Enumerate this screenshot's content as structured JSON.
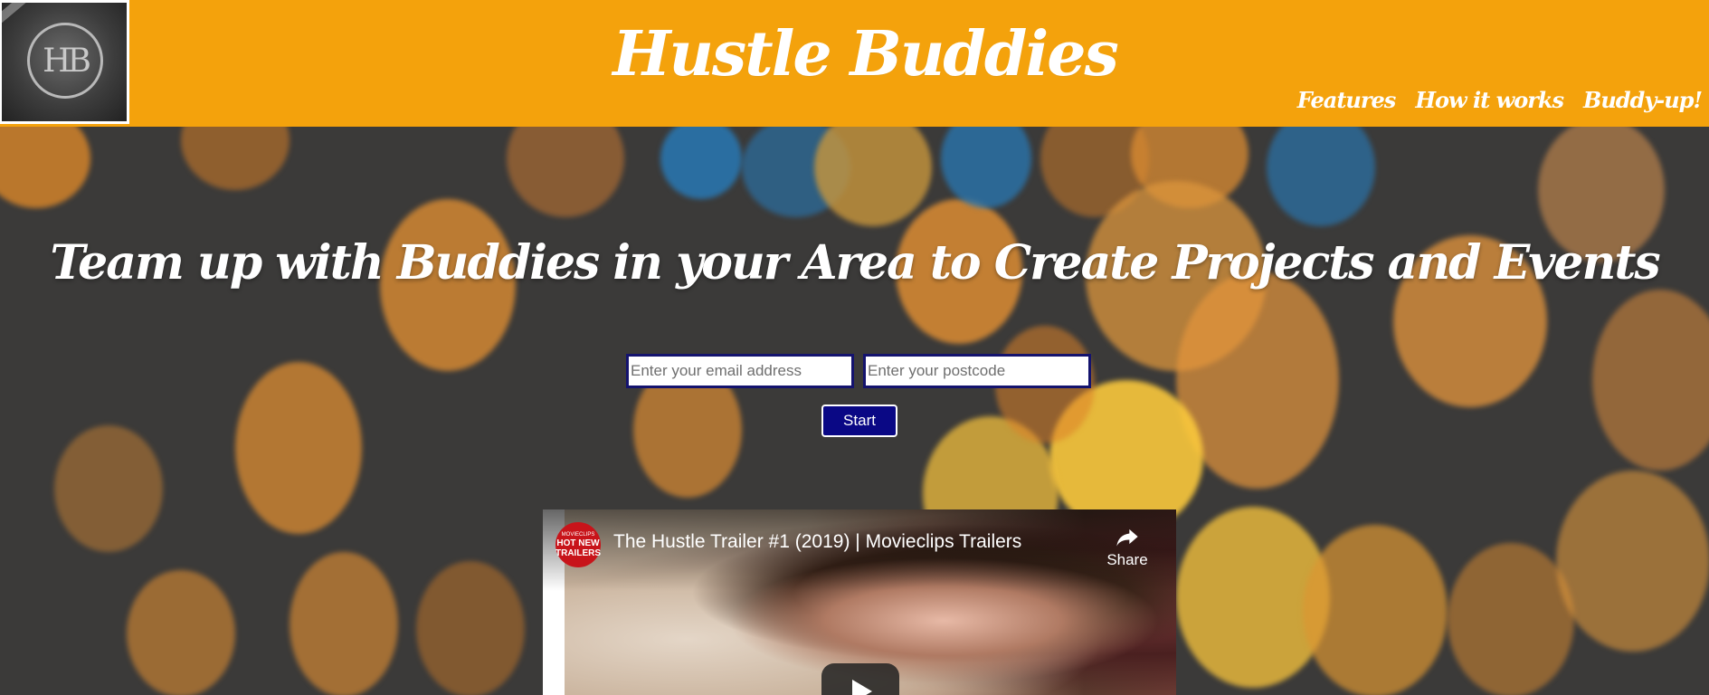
{
  "header": {
    "logo_text": "HB",
    "title": "Hustle Buddies",
    "nav": [
      {
        "label": "Features"
      },
      {
        "label": "How it works"
      },
      {
        "label": "Buddy-up!"
      }
    ],
    "background_color": "#f4a20c"
  },
  "hero": {
    "heading": "Team up with Buddies in your Area to Create Projects and Events",
    "email_placeholder": "Enter your email address",
    "postcode_placeholder": "Enter your postcode",
    "start_label": "Start",
    "button_color": "#0a0885"
  },
  "video": {
    "channel_badge_top": "MOVIECLIPS",
    "channel_badge_line1": "HOT NEW",
    "channel_badge_line2": "TRAILERS",
    "title": "The Hustle Trailer #1 (2019) | Movieclips Trailers",
    "share_label": "Share",
    "play_icon": "play-icon"
  }
}
